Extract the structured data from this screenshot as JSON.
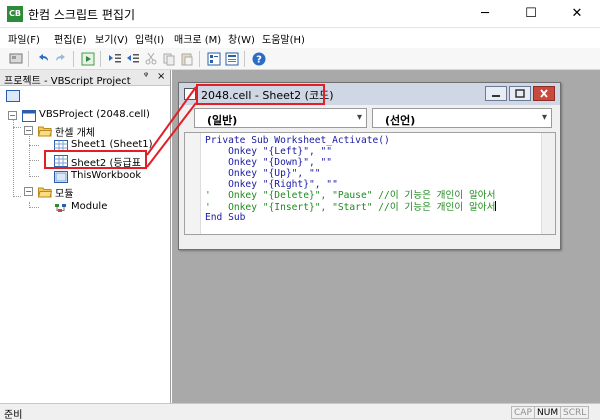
{
  "app": {
    "title": "한컴 스크립트 편집기",
    "icon_text": "CB"
  },
  "window_controls": {
    "minimize": "─",
    "maximize": "☐",
    "close": "✕"
  },
  "menu": [
    {
      "label": "파일(F)"
    },
    {
      "label": "편집(E)"
    },
    {
      "label": "보기(V)"
    },
    {
      "label": "입력(I)"
    },
    {
      "label": "매크로 (M)"
    },
    {
      "label": "창(W)"
    },
    {
      "label": "도움말(H)"
    }
  ],
  "project_panel": {
    "title": "프로젝트 - VBScript Project",
    "pin": "ᵠ",
    "close": "×",
    "tree": {
      "root": "VBSProject (2048.cell)",
      "group_objects": "한셀 개체",
      "sheet1": "Sheet1 (Sheet1)",
      "sheet2": "Sheet2 (등급표",
      "workbook": "ThisWorkbook",
      "group_modules": "모듈",
      "module": "Module"
    }
  },
  "code_window": {
    "title": "2048.cell - Sheet2 (코드)",
    "object_combo": "(일반)",
    "proc_combo": "(선언)",
    "lines": {
      "l1": "Private Sub Worksheet_Activate()",
      "l2": "    Onkey \"{Left}\", \"\"",
      "l3": "    Onkey \"{Down}\", \"\"",
      "l4": "    Onkey \"{Up}\", \"\"",
      "l5": "    Onkey \"{Right}\", \"\"",
      "l6": "'   Onkey \"{Delete}\", \"Pause\" //이 기능은 개인이 알아서",
      "l7": "'   Onkey \"{Insert}\", \"Start\" //이 기능은 개인이 알아서",
      "l8": "End Sub"
    }
  },
  "status_bar": {
    "left": "준비",
    "indicators": [
      {
        "label": "CAP",
        "active": false
      },
      {
        "label": "NUM",
        "active": true
      },
      {
        "label": "SCRL",
        "active": false
      }
    ]
  },
  "colors": {
    "highlight": "#e21f26",
    "keyword": "#1a1aa6",
    "comment": "#1f8a1f",
    "mdi_background": "#a9a9a9"
  }
}
